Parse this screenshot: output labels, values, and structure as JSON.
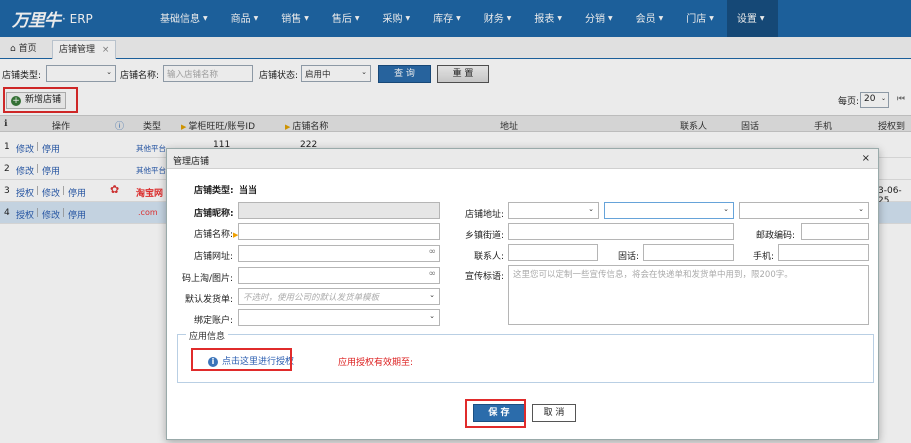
{
  "app": {
    "logo_text": "万里牛",
    "logo_suffix": "· ERP"
  },
  "nav": [
    {
      "label": "基础信息"
    },
    {
      "label": "商品"
    },
    {
      "label": "销售"
    },
    {
      "label": "售后"
    },
    {
      "label": "采购"
    },
    {
      "label": "库存"
    },
    {
      "label": "财务"
    },
    {
      "label": "报表"
    },
    {
      "label": "分销"
    },
    {
      "label": "会员"
    },
    {
      "label": "门店"
    },
    {
      "label": "设置"
    }
  ],
  "tabs": {
    "home": "首页",
    "current": "店铺管理",
    "close": "×"
  },
  "filters": {
    "type_label": "店铺类型:",
    "type_value": "",
    "name_label": "店铺名称:",
    "name_placeholder": "输入店铺名称",
    "status_label": "店铺状态:",
    "status_value": "启用中",
    "query_button": "查 询",
    "reset_button": "重 置"
  },
  "toolbar": {
    "add_button": "新增店铺",
    "per_page_label": "每页:",
    "per_page_value": "20"
  },
  "table": {
    "headers": [
      "操作",
      "类型",
      "掌柜旺旺/账号ID",
      "店铺名称",
      "地址",
      "联系人",
      "固话",
      "手机",
      "授权到"
    ],
    "rows": [
      {
        "no": "1",
        "actions": [
          "修改",
          "停用"
        ],
        "type": "其他平台",
        "account": "111",
        "name": "222",
        "date": ""
      },
      {
        "no": "2",
        "actions": [
          "修改",
          "停用"
        ],
        "type": "其他平台",
        "account": "",
        "name": "",
        "date": ""
      },
      {
        "no": "3",
        "actions": [
          "授权",
          "修改",
          "停用"
        ],
        "type": "淘宝网",
        "account": "",
        "name": "",
        "date": "3-06-25"
      },
      {
        "no": "4",
        "actions": [
          "授权",
          "修改",
          "停用"
        ],
        "type": ".com",
        "account": "",
        "name": "",
        "date": ""
      }
    ]
  },
  "modal": {
    "title": "管理店铺",
    "close": "×",
    "store_type_label": "店铺类型:",
    "store_type_value": "当当",
    "nickname_label": "店铺昵称:",
    "store_name_label": "店铺名称:",
    "store_url_label": "店铺网址:",
    "qr_label": "码上淘/图片:",
    "default_template_label": "默认发货单:",
    "default_template_placeholder": "不选时，使用公司的默认发货单模板",
    "bind_account_label": "绑定账户:",
    "address_label": "店铺地址:",
    "street_label": "乡镇街道:",
    "postcode_label": "邮政编码:",
    "contact_label": "联系人:",
    "phone_label": "固话:",
    "mobile_label": "手机:",
    "slogan_label": "宣传标语:",
    "slogan_placeholder": "这里您可以定制一些宣传信息，将会在快递单和发货单中用到，限200字。",
    "app_info_legend": "应用信息",
    "auth_link": "点击这里进行授权",
    "auth_expire": "应用授权有效期至:",
    "save_button": "保 存",
    "cancel_button": "取 消"
  },
  "colors": {
    "nav_bg": "#1f68a8",
    "highlight": "#e02b2b",
    "primary": "#2b6cab"
  }
}
